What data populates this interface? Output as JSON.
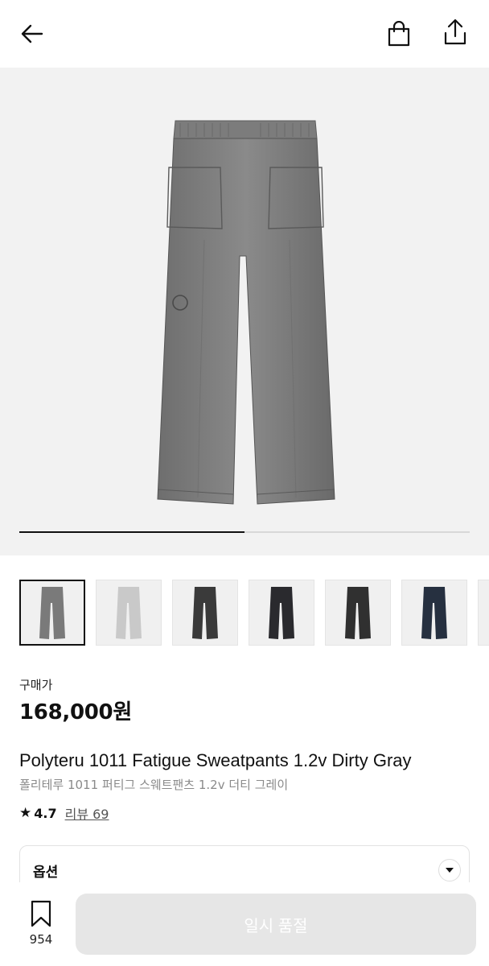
{
  "header": {
    "back_icon": "arrow-left-icon",
    "cart_icon": "shopping-bag-icon",
    "share_icon": "share-icon"
  },
  "gallery": {
    "progress": 0.5,
    "thumbnails": [
      {
        "name": "dirty-gray",
        "color": "#7a7a7a",
        "selected": true
      },
      {
        "name": "light-gray",
        "color": "#c9c9c9",
        "selected": false
      },
      {
        "name": "charcoal",
        "color": "#3a3a3a",
        "selected": false
      },
      {
        "name": "black-dark",
        "color": "#2a2a2e",
        "selected": false
      },
      {
        "name": "black",
        "color": "#303030",
        "selected": false
      },
      {
        "name": "navy",
        "color": "#263040",
        "selected": false
      }
    ]
  },
  "product": {
    "price_label": "구매가",
    "price": "168,000원",
    "title_en": "Polyteru 1011 Fatigue Sweatpants 1.2v Dirty Gray",
    "title_ko": "폴리테루 1011 퍼티그 스웨트팬츠 1.2v 더티 그레이",
    "rating": "4.7",
    "review_link": "리뷰 69"
  },
  "options": {
    "label": "옵션"
  },
  "bottom": {
    "bookmark_count": "954",
    "soldout_label": "일시 품절"
  }
}
